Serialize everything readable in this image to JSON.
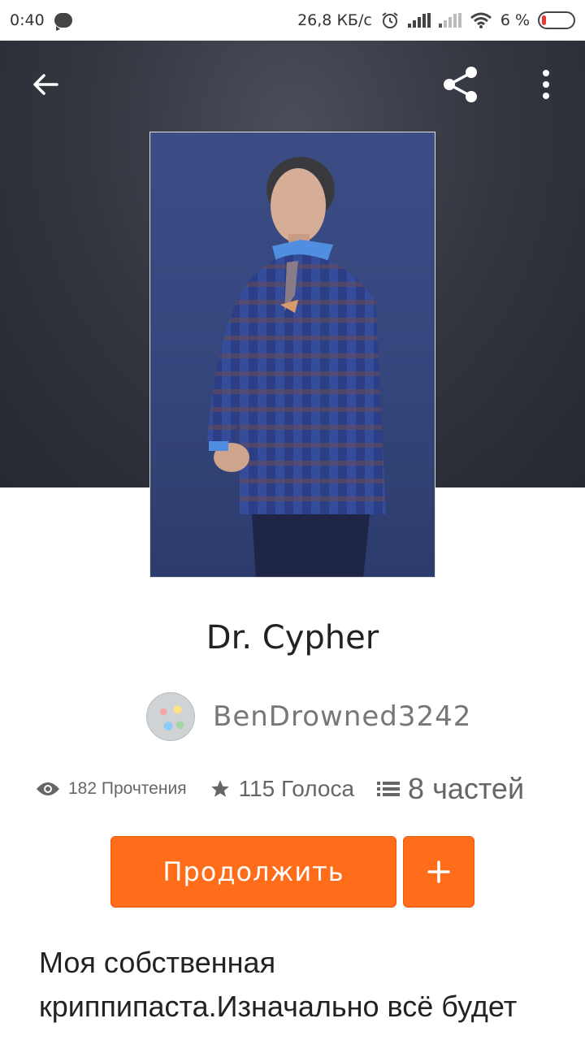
{
  "status_bar": {
    "time": "0:40",
    "network_speed": "26,8 КБ/с",
    "battery_percent": "6 %",
    "icons": [
      "chat-icon",
      "alarm-icon",
      "signal-icon",
      "signal-weak-icon",
      "wifi-icon",
      "battery-icon"
    ]
  },
  "toolbar": {
    "back_icon": "arrow-left-icon",
    "share_icon": "share-icon",
    "more_icon": "more-vertical-icon"
  },
  "story": {
    "title": "Dr. Cypher",
    "author": "BenDrowned3242",
    "reads": "182 Прочтения",
    "votes": "115 Голоса",
    "parts": "8 частей",
    "continue_label": "Продолжить",
    "add_label": "+",
    "description": "Моя собственная криппипаста.Изначально всё будет"
  },
  "colors": {
    "accent": "#ff6c1a",
    "hero_bg": "#33363f",
    "cover_bg": "#3c4d86"
  }
}
